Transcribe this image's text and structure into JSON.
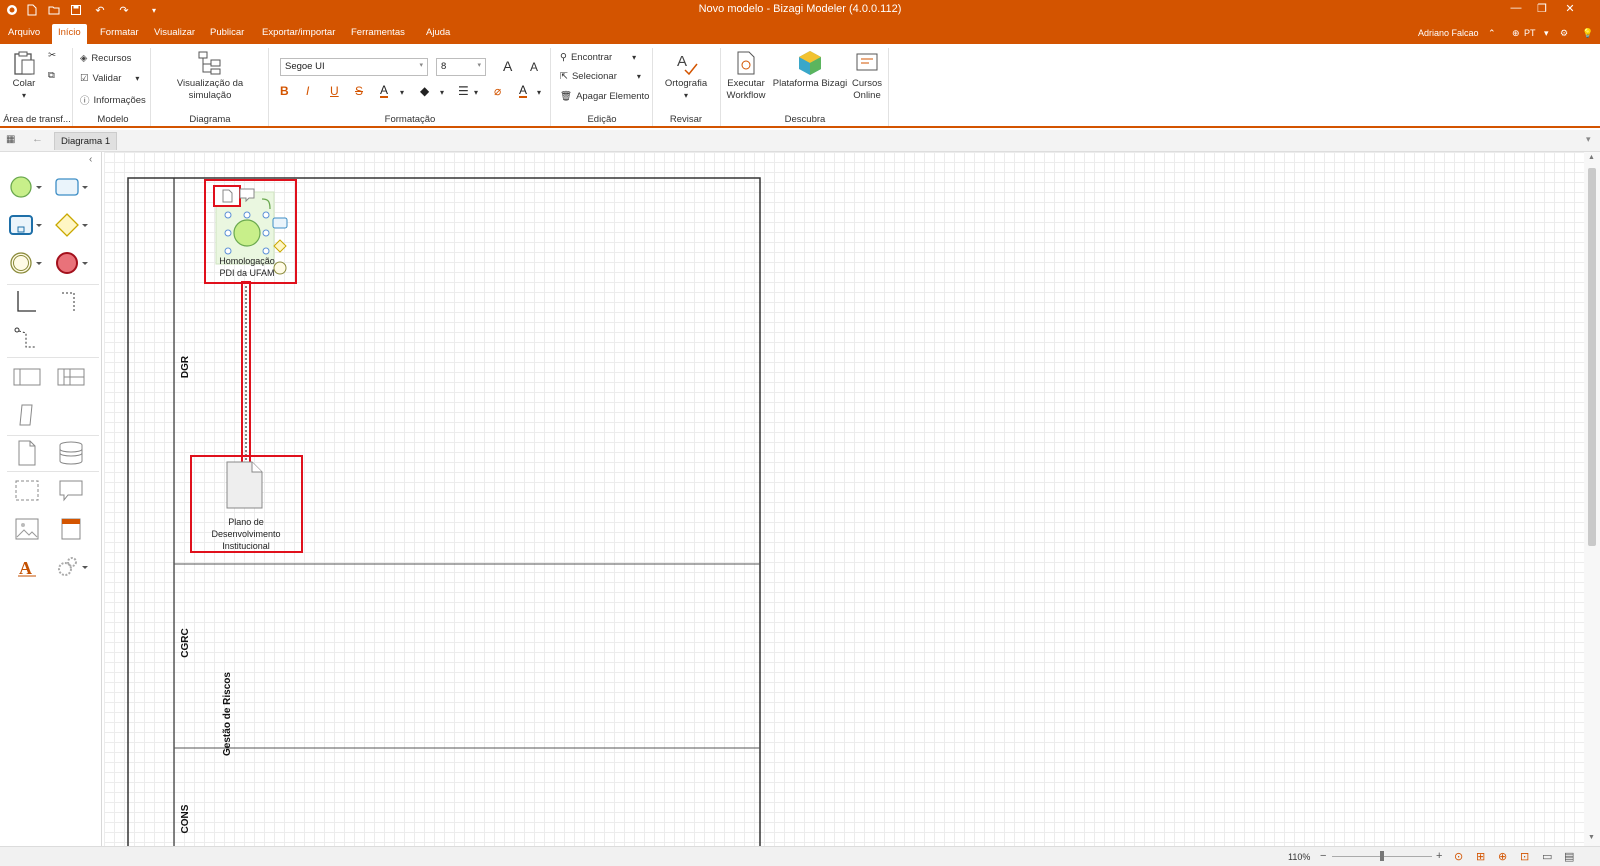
{
  "app": {
    "title": "Novo modelo - Bizagi Modeler (4.0.0.112)",
    "user": "Adriano Falcao",
    "language": "PT"
  },
  "menu": {
    "tabs": [
      "Arquivo",
      "Início",
      "Formatar",
      "Visualizar",
      "Publicar",
      "Exportar/importar",
      "Ferramentas",
      "Ajuda"
    ],
    "active": "Início"
  },
  "ribbon": {
    "clipboard": {
      "paste": "Colar",
      "group": "Área de transf..."
    },
    "model": {
      "resources": "Recursos",
      "validate": "Validar",
      "info": "Informações",
      "group": "Modelo"
    },
    "diagram": {
      "simulation": "Visualização da simulação",
      "group": "Diagrama"
    },
    "format": {
      "font": "Segoe UI",
      "size": "8",
      "group": "Formatação"
    },
    "edit": {
      "find": "Encontrar",
      "select": "Selecionar",
      "delete": "Apagar Elemento",
      "group": "Edição"
    },
    "review": {
      "spelling": "Ortografia",
      "group": "Revisar"
    },
    "discover": {
      "workflow_1": "Executar",
      "workflow_2": "Workflow",
      "platform": "Plataforma Bizagi",
      "courses_1": "Cursos",
      "courses_2": "Online",
      "group": "Descubra"
    }
  },
  "document": {
    "tab": "Diagrama 1"
  },
  "diagram": {
    "pool": "Gestão de Riscos",
    "lanes": [
      "DGR",
      "CGRC",
      "CONS"
    ],
    "start_event_label_1": "Homologação",
    "start_event_label_2": "PDI da UFAM",
    "artifact_label_1": "Plano de",
    "artifact_label_2": "Desenvolvimento",
    "artifact_label_3": "Institucional"
  },
  "status": {
    "zoom": "110%"
  },
  "colors": {
    "accent": "#d35400",
    "highlight": "#e0101c",
    "event_fill": "#c8ef8a"
  }
}
